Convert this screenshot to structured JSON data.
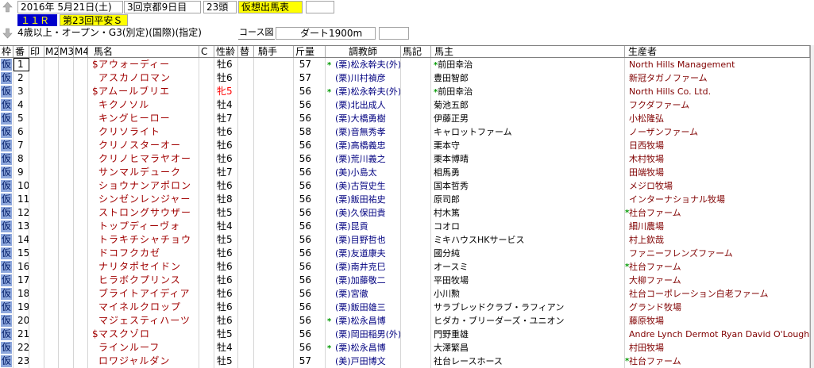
{
  "header": {
    "date": "2016年 5月21日(土)",
    "meeting": "3回京都9日目",
    "runners": "23頭",
    "mode": "仮想出馬表",
    "race_number": "１１Ｒ",
    "race_name": "第23回平安Ｓ",
    "conditions": "4歳以上・オープン・G3(別定)(国際)(指定)",
    "course_map_label": "コース図",
    "course": "ダート1900m"
  },
  "icons": {
    "prev": "prev-race-icon",
    "next": "next-race-icon"
  },
  "columns": [
    "枠",
    "番",
    "印",
    "M2",
    "M3",
    "M4",
    "馬名",
    "C",
    "性齢",
    "替",
    "騎手",
    "斤量",
    "調教師",
    "馬記",
    "馬主",
    "生産者"
  ],
  "cursor": {
    "row_index": 0,
    "column_index": 1
  },
  "colors": {
    "horse_name": "#a00000",
    "trainer": "#000080",
    "breeder": "#800000",
    "female": "#ff0000",
    "mark": "#009900",
    "waku_bg": "#8ea8dd",
    "waku_text": "#001a66",
    "race_number_bg": "#0000cc",
    "race_number_text": "#ffff00",
    "highlight": "#ffff00"
  },
  "rows": [
    {
      "waku": "仮",
      "num": "1",
      "prefix": "$",
      "name": "アウォーディー",
      "sex_age": "牡6",
      "weight": "57",
      "trainer_mark": "*",
      "trainer": "(栗)松永幹夫(外)",
      "owner_mark": "*",
      "owner": "前田幸治",
      "breeder": "North Hills Management"
    },
    {
      "waku": "仮",
      "num": "2",
      "name": "アスカノロマン",
      "sex_age": "牡6",
      "weight": "57",
      "trainer": "(栗)川村禎彦",
      "owner": "豊田智郎",
      "breeder": "新冠タガノファーム"
    },
    {
      "waku": "仮",
      "num": "3",
      "prefix": "$",
      "name": "アムールブリエ",
      "sex_age": "牝5",
      "weight": "56",
      "trainer_mark": "*",
      "trainer": "(栗)松永幹夫(外)",
      "owner_mark": "*",
      "owner": "前田幸治",
      "breeder": "North Hills Co. Ltd."
    },
    {
      "waku": "仮",
      "num": "4",
      "name": "キクノソル",
      "sex_age": "牡4",
      "weight": "56",
      "trainer": "(栗)北出成人",
      "owner": "菊池五郎",
      "breeder": "フクダファーム"
    },
    {
      "waku": "仮",
      "num": "5",
      "name": "キングヒーロー",
      "sex_age": "牡7",
      "weight": "56",
      "trainer": "(栗)大橋勇樹",
      "owner": "伊藤正男",
      "breeder": "小松隆弘"
    },
    {
      "waku": "仮",
      "num": "6",
      "name": "クリソライト",
      "sex_age": "牡6",
      "weight": "58",
      "trainer": "(栗)音無秀孝",
      "owner": "キャロットファーム",
      "breeder": "ノーザンファーム"
    },
    {
      "waku": "仮",
      "num": "7",
      "name": "クリノスターオー",
      "sex_age": "牡6",
      "weight": "56",
      "trainer": "(栗)高橋義忠",
      "owner": "栗本守",
      "breeder": "日西牧場"
    },
    {
      "waku": "仮",
      "num": "8",
      "name": "クリノヒマラヤオー",
      "sex_age": "牡6",
      "weight": "56",
      "trainer": "(栗)荒川義之",
      "owner": "栗本博晴",
      "breeder": "木村牧場"
    },
    {
      "waku": "仮",
      "num": "9",
      "name": "サンマルデューク",
      "sex_age": "牡7",
      "weight": "56",
      "trainer": "(美)小島太",
      "owner": "相馬勇",
      "breeder": "田端牧場"
    },
    {
      "waku": "仮",
      "num": "10",
      "name": "ショウナンアポロン",
      "sex_age": "牡6",
      "weight": "56",
      "trainer": "(美)古賀史生",
      "owner": "国本哲秀",
      "breeder": "メジロ牧場"
    },
    {
      "waku": "仮",
      "num": "11",
      "name": "シンゼンレンジャー",
      "sex_age": "牡8",
      "weight": "56",
      "trainer": "(栗)飯田祐史",
      "owner": "原司郎",
      "breeder": "インターナショナル牧場"
    },
    {
      "waku": "仮",
      "num": "12",
      "name": "ストロングサウザー",
      "sex_age": "牡5",
      "weight": "56",
      "trainer": "(美)久保田貴",
      "owner": "村木篤",
      "breeder_mark": "*",
      "breeder": "社台ファーム"
    },
    {
      "waku": "仮",
      "num": "13",
      "name": "トップディーヴォ",
      "sex_age": "牡4",
      "weight": "56",
      "trainer": "(栗)昆貢",
      "owner": "コオロ",
      "breeder": "細川農場"
    },
    {
      "waku": "仮",
      "num": "14",
      "name": "トラキチシャチョウ",
      "sex_age": "牡5",
      "weight": "56",
      "trainer": "(栗)目野哲也",
      "owner": "ミキハウスHKサービス",
      "breeder": "村上欽哉"
    },
    {
      "waku": "仮",
      "num": "15",
      "name": "ドコフクカゼ",
      "sex_age": "牡6",
      "weight": "56",
      "trainer": "(栗)友道康夫",
      "owner": "國分純",
      "breeder": "ファニーフレンズファーム"
    },
    {
      "waku": "仮",
      "num": "16",
      "name": "ナリタポセイドン",
      "sex_age": "牡6",
      "weight": "56",
      "trainer": "(栗)南井克巳",
      "owner": "オースミ",
      "breeder_mark": "*",
      "breeder": "社台ファーム"
    },
    {
      "waku": "仮",
      "num": "17",
      "name": "ヒラボクプリンス",
      "sex_age": "牡6",
      "weight": "56",
      "trainer": "(栗)加藤敬二",
      "owner": "平田牧場",
      "breeder": "大柳ファーム"
    },
    {
      "waku": "仮",
      "num": "18",
      "name": "ブライトアイディア",
      "sex_age": "牡6",
      "weight": "56",
      "trainer": "(栗)宮徹",
      "owner": "小川勲",
      "breeder": "社台コーポレーション白老ファーム"
    },
    {
      "waku": "仮",
      "num": "19",
      "name": "マイネルクロップ",
      "sex_age": "牡6",
      "weight": "56",
      "trainer": "(栗)飯田雄三",
      "owner": "サラブレッドクラブ・ラフィアン",
      "breeder": "グランド牧場"
    },
    {
      "waku": "仮",
      "num": "20",
      "name": "マジェスティハーツ",
      "sex_age": "牡6",
      "weight": "56",
      "trainer_mark": "*",
      "trainer": "(栗)松永昌博",
      "owner": "ヒダカ・ブリーダーズ・ユニオン",
      "breeder": "藤原牧場"
    },
    {
      "waku": "仮",
      "num": "21",
      "prefix": "$",
      "name": "マスクゾロ",
      "sex_age": "牡5",
      "weight": "56",
      "trainer": "(栗)岡田稲男(外)",
      "owner": "門野重雄",
      "breeder": "Andre Lynch Dermot Ryan David O'Lough"
    },
    {
      "waku": "仮",
      "num": "22",
      "name": "ラインルーフ",
      "sex_age": "牡4",
      "weight": "56",
      "trainer_mark": "*",
      "trainer": "(栗)松永昌博",
      "owner": "大澤繁昌",
      "breeder": "村田牧場"
    },
    {
      "waku": "仮",
      "num": "23",
      "name": "ロワジャルダン",
      "sex_age": "牡5",
      "weight": "57",
      "trainer": "(美)戸田博文",
      "owner": "社台レースホース",
      "breeder_mark": "*",
      "breeder": "社台ファーム"
    }
  ]
}
